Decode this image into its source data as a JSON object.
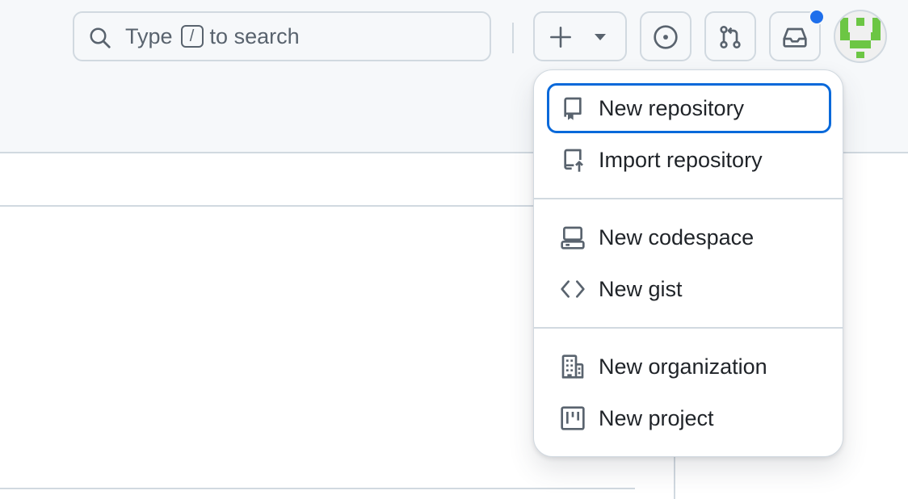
{
  "search": {
    "prefix": "Type",
    "key": "/",
    "suffix": "to search"
  },
  "header": {
    "buttons": [
      {
        "icon": "plus-icon",
        "caret": "triangle-down-icon"
      },
      {
        "icon": "issue-opened-icon"
      },
      {
        "icon": "git-pull-request-icon"
      },
      {
        "icon": "inbox-icon"
      }
    ],
    "notification_color": "#1f6feb",
    "avatar_color": "#6cc644"
  },
  "menu": {
    "groups": [
      [
        {
          "label": "New repository",
          "icon": "repo-icon",
          "focused": true
        },
        {
          "label": "Import repository",
          "icon": "repo-push-icon"
        }
      ],
      [
        {
          "label": "New codespace",
          "icon": "codespaces-icon"
        },
        {
          "label": "New gist",
          "icon": "code-icon"
        }
      ],
      [
        {
          "label": "New organization",
          "icon": "organization-icon"
        },
        {
          "label": "New project",
          "icon": "project-icon"
        }
      ]
    ]
  },
  "colors": {
    "focus": "#0969da",
    "border": "#d1d9e0",
    "text": "#1f2328",
    "muted": "#59636e"
  }
}
